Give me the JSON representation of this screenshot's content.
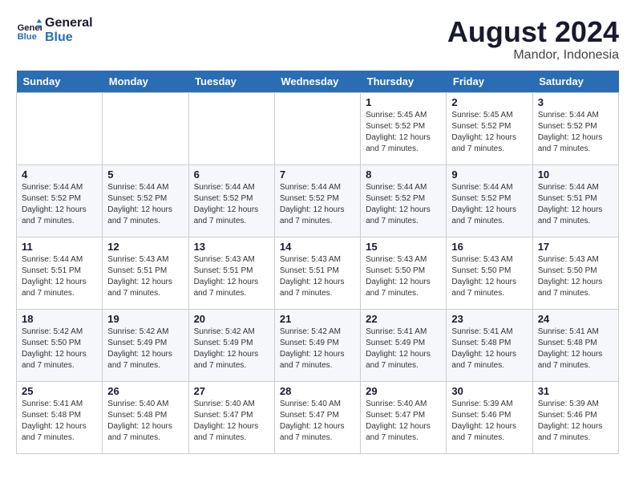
{
  "logo": {
    "line1": "General",
    "line2": "Blue"
  },
  "title": "August 2024",
  "location": "Mandor, Indonesia",
  "weekdays": [
    "Sunday",
    "Monday",
    "Tuesday",
    "Wednesday",
    "Thursday",
    "Friday",
    "Saturday"
  ],
  "weeks": [
    [
      {
        "day": "",
        "info": ""
      },
      {
        "day": "",
        "info": ""
      },
      {
        "day": "",
        "info": ""
      },
      {
        "day": "",
        "info": ""
      },
      {
        "day": "1",
        "info": "Sunrise: 5:45 AM\nSunset: 5:52 PM\nDaylight: 12 hours and 7 minutes."
      },
      {
        "day": "2",
        "info": "Sunrise: 5:45 AM\nSunset: 5:52 PM\nDaylight: 12 hours and 7 minutes."
      },
      {
        "day": "3",
        "info": "Sunrise: 5:44 AM\nSunset: 5:52 PM\nDaylight: 12 hours and 7 minutes."
      }
    ],
    [
      {
        "day": "4",
        "info": "Sunrise: 5:44 AM\nSunset: 5:52 PM\nDaylight: 12 hours and 7 minutes."
      },
      {
        "day": "5",
        "info": "Sunrise: 5:44 AM\nSunset: 5:52 PM\nDaylight: 12 hours and 7 minutes."
      },
      {
        "day": "6",
        "info": "Sunrise: 5:44 AM\nSunset: 5:52 PM\nDaylight: 12 hours and 7 minutes."
      },
      {
        "day": "7",
        "info": "Sunrise: 5:44 AM\nSunset: 5:52 PM\nDaylight: 12 hours and 7 minutes."
      },
      {
        "day": "8",
        "info": "Sunrise: 5:44 AM\nSunset: 5:52 PM\nDaylight: 12 hours and 7 minutes."
      },
      {
        "day": "9",
        "info": "Sunrise: 5:44 AM\nSunset: 5:52 PM\nDaylight: 12 hours and 7 minutes."
      },
      {
        "day": "10",
        "info": "Sunrise: 5:44 AM\nSunset: 5:51 PM\nDaylight: 12 hours and 7 minutes."
      }
    ],
    [
      {
        "day": "11",
        "info": "Sunrise: 5:44 AM\nSunset: 5:51 PM\nDaylight: 12 hours and 7 minutes."
      },
      {
        "day": "12",
        "info": "Sunrise: 5:43 AM\nSunset: 5:51 PM\nDaylight: 12 hours and 7 minutes."
      },
      {
        "day": "13",
        "info": "Sunrise: 5:43 AM\nSunset: 5:51 PM\nDaylight: 12 hours and 7 minutes."
      },
      {
        "day": "14",
        "info": "Sunrise: 5:43 AM\nSunset: 5:51 PM\nDaylight: 12 hours and 7 minutes."
      },
      {
        "day": "15",
        "info": "Sunrise: 5:43 AM\nSunset: 5:50 PM\nDaylight: 12 hours and 7 minutes."
      },
      {
        "day": "16",
        "info": "Sunrise: 5:43 AM\nSunset: 5:50 PM\nDaylight: 12 hours and 7 minutes."
      },
      {
        "day": "17",
        "info": "Sunrise: 5:43 AM\nSunset: 5:50 PM\nDaylight: 12 hours and 7 minutes."
      }
    ],
    [
      {
        "day": "18",
        "info": "Sunrise: 5:42 AM\nSunset: 5:50 PM\nDaylight: 12 hours and 7 minutes."
      },
      {
        "day": "19",
        "info": "Sunrise: 5:42 AM\nSunset: 5:49 PM\nDaylight: 12 hours and 7 minutes."
      },
      {
        "day": "20",
        "info": "Sunrise: 5:42 AM\nSunset: 5:49 PM\nDaylight: 12 hours and 7 minutes."
      },
      {
        "day": "21",
        "info": "Sunrise: 5:42 AM\nSunset: 5:49 PM\nDaylight: 12 hours and 7 minutes."
      },
      {
        "day": "22",
        "info": "Sunrise: 5:41 AM\nSunset: 5:49 PM\nDaylight: 12 hours and 7 minutes."
      },
      {
        "day": "23",
        "info": "Sunrise: 5:41 AM\nSunset: 5:48 PM\nDaylight: 12 hours and 7 minutes."
      },
      {
        "day": "24",
        "info": "Sunrise: 5:41 AM\nSunset: 5:48 PM\nDaylight: 12 hours and 7 minutes."
      }
    ],
    [
      {
        "day": "25",
        "info": "Sunrise: 5:41 AM\nSunset: 5:48 PM\nDaylight: 12 hours and 7 minutes."
      },
      {
        "day": "26",
        "info": "Sunrise: 5:40 AM\nSunset: 5:48 PM\nDaylight: 12 hours and 7 minutes."
      },
      {
        "day": "27",
        "info": "Sunrise: 5:40 AM\nSunset: 5:47 PM\nDaylight: 12 hours and 7 minutes."
      },
      {
        "day": "28",
        "info": "Sunrise: 5:40 AM\nSunset: 5:47 PM\nDaylight: 12 hours and 7 minutes."
      },
      {
        "day": "29",
        "info": "Sunrise: 5:40 AM\nSunset: 5:47 PM\nDaylight: 12 hours and 7 minutes."
      },
      {
        "day": "30",
        "info": "Sunrise: 5:39 AM\nSunset: 5:46 PM\nDaylight: 12 hours and 7 minutes."
      },
      {
        "day": "31",
        "info": "Sunrise: 5:39 AM\nSunset: 5:46 PM\nDaylight: 12 hours and 7 minutes."
      }
    ]
  ]
}
